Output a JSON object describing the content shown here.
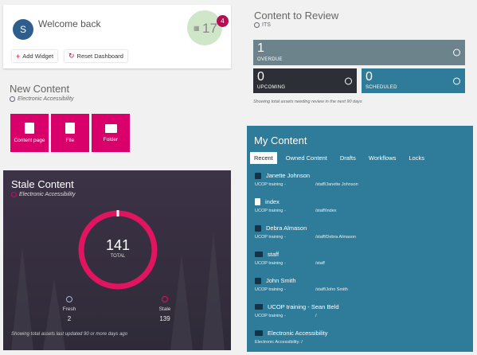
{
  "welcome": {
    "avatar_initial": "S",
    "greeting": "Welcome back",
    "notification_count": "17",
    "notification_badge": "4",
    "add_widget_label": "Add Widget",
    "reset_dashboard_label": "Reset Dashboard"
  },
  "new_content": {
    "title": "New Content",
    "site": "Electronic Accessibility",
    "tiles": [
      "Content page",
      "File",
      "Folder"
    ]
  },
  "stale_content": {
    "title": "Stale Content",
    "site": "Electronic Accessibility",
    "total": "141",
    "total_label": "TOTAL",
    "fresh_label": "Fresh",
    "fresh_value": "2",
    "stale_label": "Stale",
    "stale_value": "139",
    "footnote": "Showing total assets last updated 90 or more days ago"
  },
  "content_review": {
    "title": "Content to Review",
    "site": "ITS",
    "overdue_count": "1",
    "overdue_label": "OVERDUE",
    "upcoming_count": "0",
    "upcoming_label": "UPCOMING",
    "scheduled_count": "0",
    "scheduled_label": "SCHEDULED",
    "footnote": "Showing total assets needing review in the next 90 days"
  },
  "my_content": {
    "title": "My Content",
    "tabs": [
      "Recent",
      "Owned Content",
      "Drafts",
      "Workflows",
      "Locks"
    ],
    "items": [
      {
        "name": "Janette Johnson",
        "site": "UCOP training -",
        "path": "/staff/Janette Johnson",
        "icon": "cube-icon"
      },
      {
        "name": "index",
        "site": "UCOP training -",
        "path": "/staff/index",
        "icon": "page-icon"
      },
      {
        "name": "Debra Almason",
        "site": "UCOP training -",
        "path": "/staff/Debra Almason",
        "icon": "cube-icon"
      },
      {
        "name": "staff",
        "site": "UCOP training -",
        "path": "/staff",
        "icon": "folder-icon"
      },
      {
        "name": "John Smith",
        "site": "UCOP training -",
        "path": "/staff/John Smith",
        "icon": "cube-icon"
      },
      {
        "name": "UCOP training - Sean Beld",
        "site": "UCOP training -",
        "path": "/",
        "icon": "folder-icon"
      },
      {
        "name": "Electronic Accessibility",
        "site": "Electronic Accessibility: /",
        "path": "",
        "icon": "folder-icon"
      }
    ]
  },
  "colors": {
    "magenta": "#d9006b",
    "teal": "#2e7c9a",
    "overdue": "#6d838c",
    "upcoming": "#2d2f36"
  }
}
